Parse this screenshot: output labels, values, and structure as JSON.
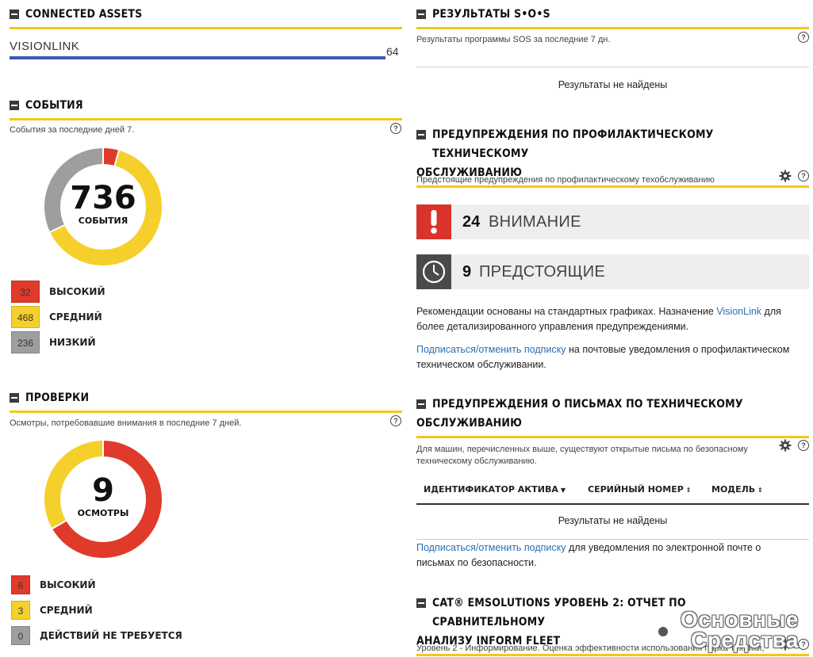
{
  "connected_assets": {
    "title": "CONNECTED ASSETS",
    "row_label": "VISIONLINK",
    "row_value": "64",
    "bar_fraction": 1.0
  },
  "events": {
    "title": "СОБЫТИЯ",
    "subtitle": "События за последние дней 7.",
    "total": "736",
    "caption": "СОБЫТИЯ",
    "legend": [
      {
        "count": "32",
        "label": "ВЫСОКИЙ",
        "color": "#e03a2b"
      },
      {
        "count": "468",
        "label": "СРЕДНИЙ",
        "color": "#f5d02c"
      },
      {
        "count": "236",
        "label": "НИЗКИЙ",
        "color": "#9e9e9e"
      }
    ]
  },
  "inspections": {
    "title": "ПРОВЕРКИ",
    "subtitle": "Осмотры, потребовавшие внимания в последние 7 дней.",
    "total": "9",
    "caption": "ОСМОТРЫ",
    "legend": [
      {
        "count": "6",
        "label": "ВЫСОКИЙ",
        "color": "#e03a2b"
      },
      {
        "count": "3",
        "label": "СРЕДНИЙ",
        "color": "#f5d02c"
      },
      {
        "count": "0",
        "label": "ДЕЙСТВИЙ НЕ ТРЕБУЕТСЯ",
        "color": "#9e9e9e"
      }
    ]
  },
  "sos": {
    "title": "РЕЗУЛЬТАТЫ S•O•S",
    "subtitle": "Результаты программы SOS за последние 7 дн.",
    "empty": "Результаты не найдены"
  },
  "pm": {
    "title_line1": "ПРЕДУПРЕЖДЕНИЯ ПО ПРОФИЛАКТИЧЕСКОМУ ТЕХНИЧЕСКОМУ",
    "title_line2": "ОБСЛУЖИВАНИЮ",
    "subtitle": "Предстоящие предупреждения по профилактическому техобслуживанию",
    "attention_count": "24",
    "attention_label": "ВНИМАНИЕ",
    "upcoming_count": "9",
    "upcoming_label": "ПРЕДСТОЯЩИЕ",
    "rec_text_1": "Рекомендации основаны на стандартных графиках. Назначение ",
    "rec_link": "VisionLink",
    "rec_text_2": " для более детализированного управления предупреждениями.",
    "sub_link": "Подписаться/отменить подписку",
    "sub_text": " на почтовые уведомления о профилактическом техническом обслуживании."
  },
  "letters": {
    "title_line1": "ПРЕДУПРЕЖДЕНИЯ О ПИСЬМАХ ПО ТЕХНИЧЕСКОМУ",
    "title_line2": "ОБСЛУЖИВАНИЮ",
    "subtitle": "Для машин, перечисленных выше, существуют открытые письма по безопасному техническому обслуживанию.",
    "col_asset": "ИДЕНТИФИКАТОР АКТИВА",
    "col_serial": "СЕРИЙНЫЙ НОМЕР",
    "col_model": "МОДЕЛЬ",
    "empty": "Результаты не найдены",
    "sub_link": "Подписаться/отменить подписку",
    "sub_text": " для уведомления по электронной почте о письмах по безопасности."
  },
  "emsolutions": {
    "title_line1": "CAT® EMSOLUTIONS УРОВЕНЬ 2: ОТЧЕТ ПО СРАВНИТЕЛЬНОМУ",
    "title_line2": "АНАЛИЗУ INFORM FLEET",
    "subtitle": "Уровень 2 - Информирование. Оценка эффективности использования парка техники,"
  },
  "watermark": {
    "line1": "Основные",
    "line2": "Средства"
  },
  "icons": {
    "help": "?",
    "gear": "gear-icon",
    "attention": "exclamation-icon",
    "upcoming": "clock-icon"
  }
}
